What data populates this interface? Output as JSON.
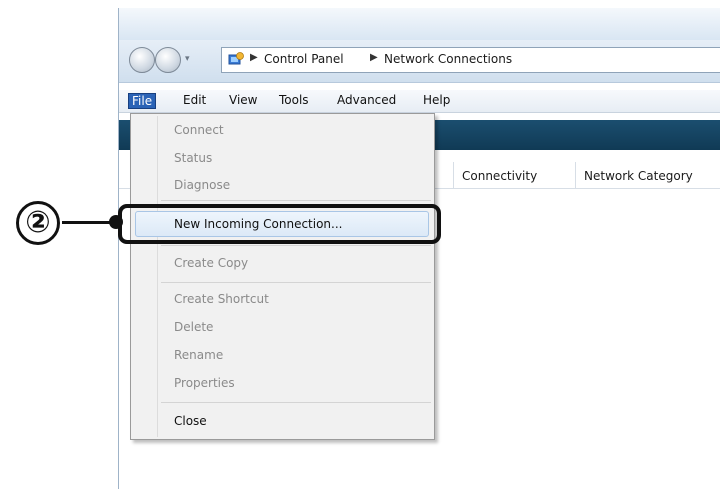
{
  "address_bar": {
    "breadcrumbs": [
      "Control Panel",
      "Network Connections"
    ],
    "separator": "▶"
  },
  "menubar": {
    "items": [
      "File",
      "Edit",
      "View",
      "Tools",
      "Advanced",
      "Help"
    ],
    "active": "File"
  },
  "columns": [
    "Connectivity",
    "Network Category"
  ],
  "file_menu": {
    "items": [
      {
        "label": "Connect",
        "enabled": false
      },
      {
        "label": "Status",
        "enabled": false
      },
      {
        "label": "Diagnose",
        "enabled": false
      },
      {
        "label": "New Incoming Connection...",
        "enabled": true,
        "highlighted": true
      },
      {
        "label": "Create Copy",
        "enabled": false
      },
      {
        "label": "Create Shortcut",
        "enabled": false
      },
      {
        "label": "Delete",
        "enabled": false
      },
      {
        "label": "Rename",
        "enabled": false
      },
      {
        "label": "Properties",
        "enabled": false
      },
      {
        "label": "Close",
        "enabled": true
      }
    ]
  },
  "annotation": {
    "step": "②"
  },
  "colors": {
    "accent": "#2b63b6",
    "toolbar": "#1b4e6f",
    "highlight_border": "#a9c6e6",
    "callout": "#111111"
  }
}
